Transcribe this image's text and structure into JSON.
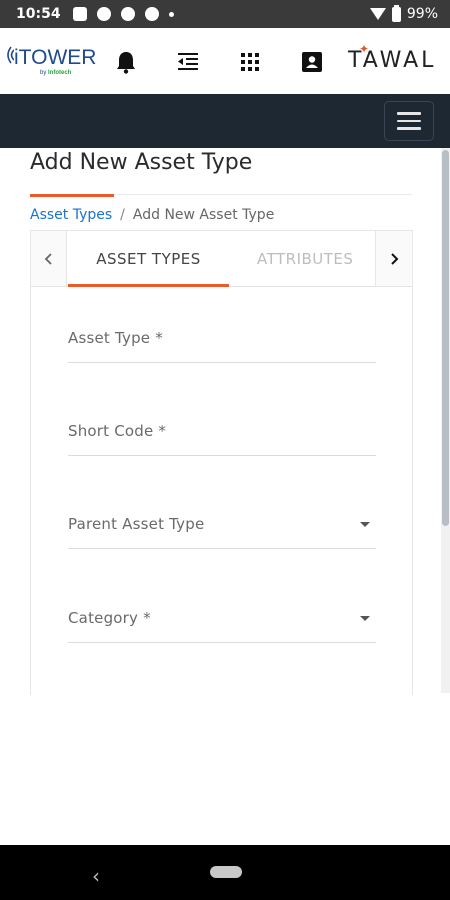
{
  "status_bar": {
    "time": "10:54",
    "battery": "99%"
  },
  "header": {
    "logo_main": "iTOWER",
    "logo_sub_by": "by",
    "logo_sub_brand": "Infotech",
    "partner_logo": "TAWAL",
    "icons": [
      "bell-icon",
      "outdent-icon",
      "apps-grid-icon",
      "contact-card-icon"
    ]
  },
  "page": {
    "title": "Add New Asset Type"
  },
  "breadcrumb": {
    "link": "Asset Types",
    "separator": "/",
    "current": "Add New Asset Type"
  },
  "tabs": [
    {
      "label": "ASSET TYPES",
      "active": true
    },
    {
      "label": "ATTRIBUTES",
      "active": false
    }
  ],
  "form": {
    "fields": [
      {
        "label": "Asset Type *",
        "type": "text"
      },
      {
        "label": "Short Code *",
        "type": "text"
      },
      {
        "label": "Parent Asset Type",
        "type": "select"
      },
      {
        "label": "Category *",
        "type": "select"
      }
    ]
  },
  "colors": {
    "accent": "#ea5a2a",
    "nav_bar": "#1d2833",
    "link": "#1a73c8"
  }
}
